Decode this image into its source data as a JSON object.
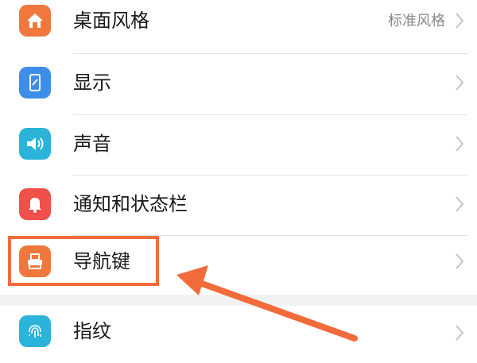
{
  "colors": {
    "accent_highlight": "#f26b3a",
    "desktop_icon": "#f0783c",
    "display_icon": "#3d8ee8",
    "sound_icon": "#2cb3d9",
    "notify_icon": "#f0504a",
    "nav_icon": "#f0783c",
    "fingerprint_icon": "#2cb3d9",
    "chevron": "#c4c4c4"
  },
  "settings": {
    "items": [
      {
        "label": "桌面风格",
        "value": "标准风格",
        "icon": "home-icon"
      },
      {
        "label": "显示",
        "value": "",
        "icon": "display-icon"
      },
      {
        "label": "声音",
        "value": "",
        "icon": "speaker-icon"
      },
      {
        "label": "通知和状态栏",
        "value": "",
        "icon": "bell-icon"
      },
      {
        "label": "导航键",
        "value": "",
        "icon": "navigation-key-icon"
      },
      {
        "label": "指纹",
        "value": "",
        "icon": "fingerprint-icon"
      }
    ]
  }
}
